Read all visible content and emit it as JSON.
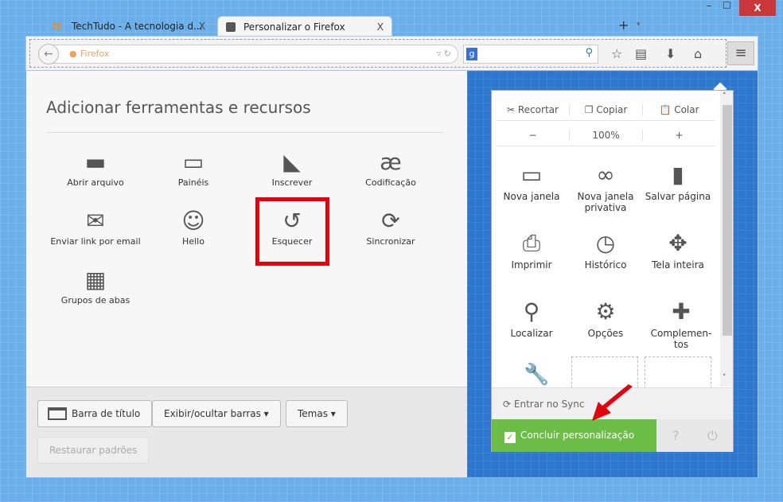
{
  "window": {
    "minimize": "–",
    "maximize": "☐",
    "close": "X"
  },
  "tabs": [
    {
      "label": "TechTudo - A tecnologia d...",
      "close": "X"
    },
    {
      "label": "Personalizar o Firefox",
      "close": "X"
    }
  ],
  "newtab": "+",
  "toolbar": {
    "url_identity": "Firefox",
    "search_engine": "g"
  },
  "palette": {
    "title": "Adicionar ferramentas e recursos",
    "items": [
      {
        "label": "Abrir arquivo",
        "icon": "folder-icon"
      },
      {
        "label": "Painéis",
        "icon": "sidebar-icon"
      },
      {
        "label": "Inscrever",
        "icon": "rss-icon"
      },
      {
        "label": "Codificação",
        "icon": "encoding-icon"
      },
      {
        "label": "Enviar link por email",
        "icon": "email-icon"
      },
      {
        "label": "Hello",
        "icon": "hello-icon"
      },
      {
        "label": "Esquecer",
        "icon": "forget-icon",
        "highlighted": true
      },
      {
        "label": "Sincronizar",
        "icon": "sync-icon"
      },
      {
        "label": "Grupos de abas",
        "icon": "tab-groups-icon"
      }
    ]
  },
  "bottom": {
    "title_bar": "Barra de título",
    "toolbars": "Exibir/ocultar barras ▾",
    "themes": "Temas ▾",
    "restore": "Restaurar padrões"
  },
  "menu": {
    "cut": "Recortar",
    "copy": "Copiar",
    "paste": "Colar",
    "zoom_out": "−",
    "zoom": "100%",
    "zoom_in": "+",
    "items": [
      {
        "label": "Nova janela"
      },
      {
        "label": "Nova janela privativa"
      },
      {
        "label": "Salvar página"
      },
      {
        "label": "Imprimir"
      },
      {
        "label": "Histórico"
      },
      {
        "label": "Tela inteira"
      },
      {
        "label": "Localizar"
      },
      {
        "label": "Opções"
      },
      {
        "label": "Complemen-tos"
      }
    ],
    "sync": "Entrar no Sync",
    "done": "Concluir personalização"
  },
  "colors": {
    "highlight": "#e2000f",
    "done": "#6bbd45",
    "customize_bg": "#2d78ce"
  }
}
